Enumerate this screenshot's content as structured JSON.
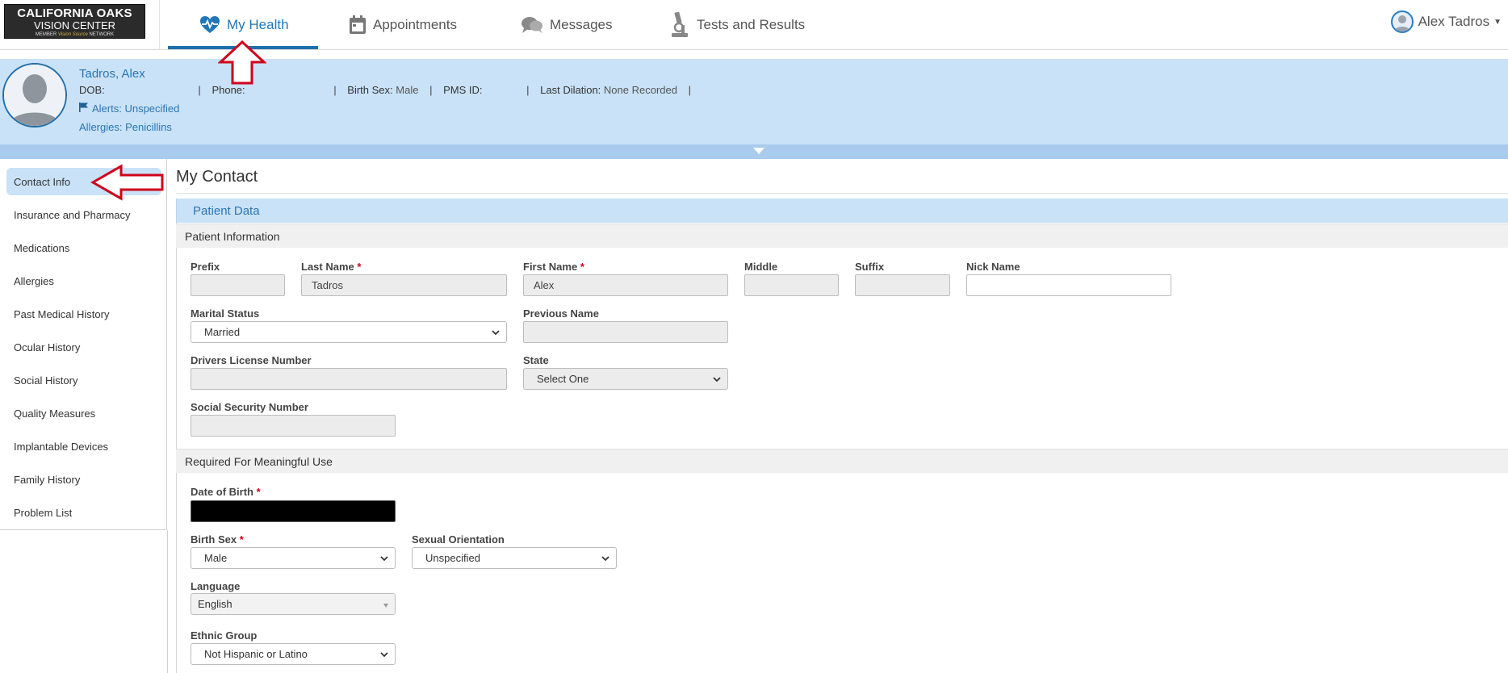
{
  "logo": {
    "line1": "CALIFORNIA OAKS",
    "line2": "VISION CENTER",
    "line3_a": "MEMBER",
    "line3_b": "Vision Source",
    "line3_c": "NETWORK"
  },
  "nav": {
    "tabs": [
      {
        "label": "My Health",
        "icon": "heart-pulse-icon"
      },
      {
        "label": "Appointments",
        "icon": "calendar-icon"
      },
      {
        "label": "Messages",
        "icon": "chat-bubbles-icon"
      },
      {
        "label": "Tests and Results",
        "icon": "microscope-icon"
      }
    ],
    "active_tab": "My Health",
    "user": "Alex Tadros"
  },
  "patient": {
    "name": "Tadros, Alex",
    "dob_label": "DOB:",
    "dob_value": "",
    "phone_label": "Phone:",
    "phone_value": "",
    "birth_sex_label": "Birth Sex:",
    "birth_sex_value": "Male",
    "pms_label": "PMS ID:",
    "pms_value": "",
    "last_dilation_label": "Last Dilation:",
    "last_dilation_value": "None Recorded",
    "alerts": "Alerts: Unspecified",
    "allergies": "Allergies: Penicillins"
  },
  "sidebar": {
    "items": [
      "Contact Info",
      "Insurance and Pharmacy",
      "Medications",
      "Allergies",
      "Past Medical History",
      "Ocular History",
      "Social History",
      "Quality Measures",
      "Implantable Devices",
      "Family History",
      "Problem List"
    ],
    "active": "Contact Info"
  },
  "main": {
    "title": "My Contact",
    "panel_title": "Patient Data",
    "section1": "Patient Information",
    "section2": "Required For Meaningful Use",
    "required_mark": "*",
    "fields": {
      "prefix": {
        "label": "Prefix",
        "value": ""
      },
      "last_name": {
        "label": "Last Name",
        "value": "Tadros"
      },
      "first_name": {
        "label": "First Name",
        "value": "Alex"
      },
      "middle": {
        "label": "Middle",
        "value": ""
      },
      "suffix": {
        "label": "Suffix",
        "value": ""
      },
      "nick_name": {
        "label": "Nick Name",
        "value": ""
      },
      "marital_status": {
        "label": "Marital Status",
        "value": "Married"
      },
      "previous_name": {
        "label": "Previous Name",
        "value": ""
      },
      "drivers_license": {
        "label": "Drivers License Number",
        "value": ""
      },
      "state": {
        "label": "State",
        "value": "Select One"
      },
      "ssn": {
        "label": "Social Security Number",
        "value": ""
      },
      "dob": {
        "label": "Date of Birth",
        "value": ""
      },
      "birth_sex": {
        "label": "Birth Sex",
        "value": "Male"
      },
      "sexual_orientation": {
        "label": "Sexual Orientation",
        "value": "Unspecified"
      },
      "language": {
        "label": "Language",
        "value": "English"
      },
      "ethnic_group": {
        "label": "Ethnic Group",
        "value": "Not Hispanic or Latino"
      }
    }
  },
  "colors": {
    "accent": "#2176b8",
    "banner": "#c9e2f7",
    "annotation_arrow": "#d0021b"
  }
}
